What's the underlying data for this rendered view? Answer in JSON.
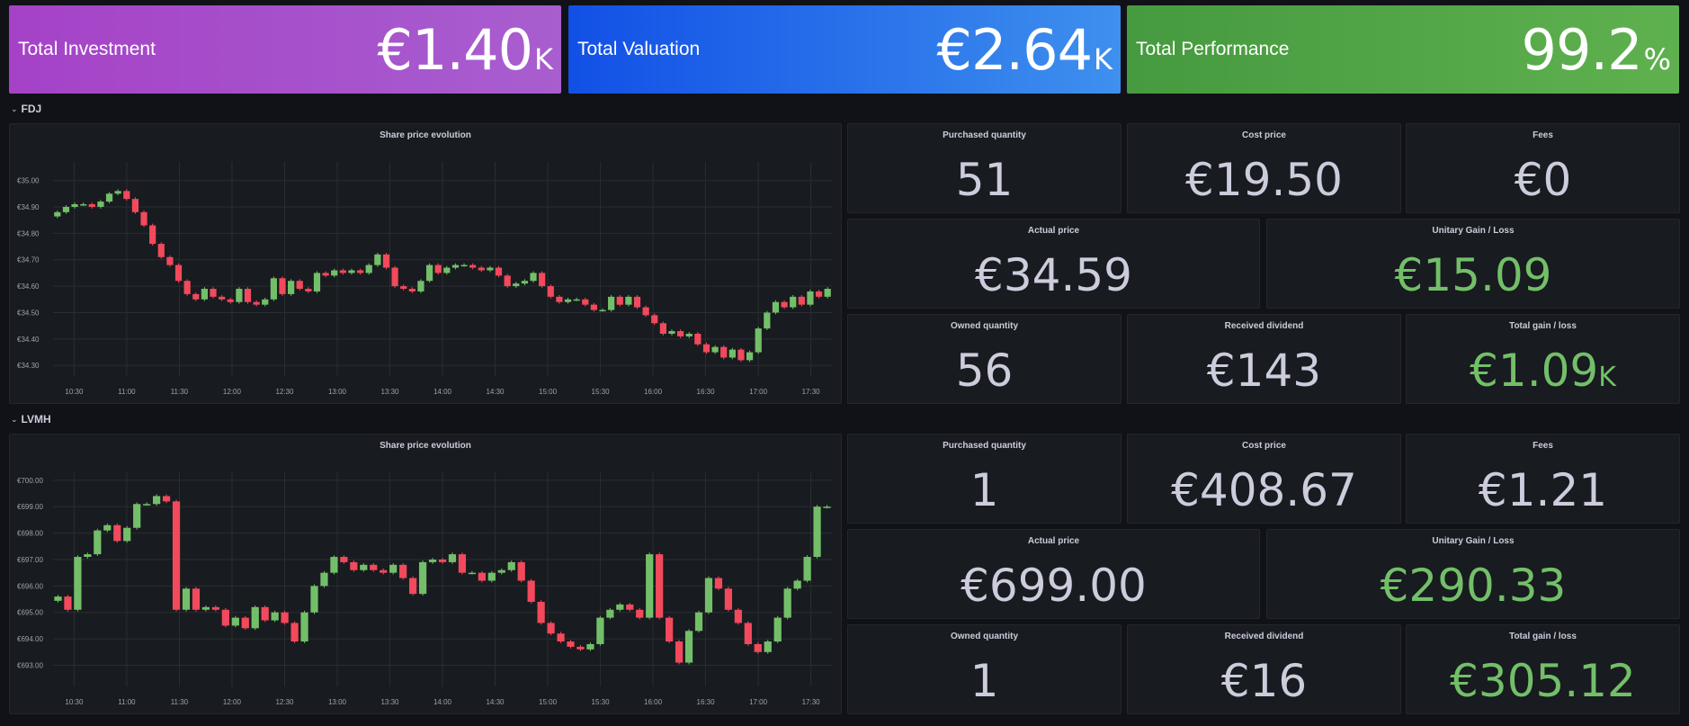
{
  "top": [
    {
      "label": "Total Investment",
      "value": "€1.40",
      "unit": "K",
      "gradient": [
        "#a542c7",
        "#a85ecf"
      ]
    },
    {
      "label": "Total Valuation",
      "value": "€2.64",
      "unit": "K",
      "gradient": [
        "#1250e6",
        "#3e90ee"
      ]
    },
    {
      "label": "Total Performance",
      "value": "99.2",
      "unit": "%",
      "gradient": [
        "#469a3f",
        "#5fb14f"
      ]
    }
  ],
  "fdj": {
    "row_title": "FDJ",
    "chart_title": "Share price evolution",
    "stats": {
      "purchased_quantity": {
        "label": "Purchased quantity",
        "value": "51"
      },
      "cost_price": {
        "label": "Cost price",
        "value": "€19.50"
      },
      "fees": {
        "label": "Fees",
        "value": "€0"
      },
      "actual_price": {
        "label": "Actual price",
        "value": "€34.59"
      },
      "unitary_gain": {
        "label": "Unitary Gain / Loss",
        "value": "€15.09"
      },
      "owned_quantity": {
        "label": "Owned quantity",
        "value": "56"
      },
      "received_dividend": {
        "label": "Received dividend",
        "value": "€143"
      },
      "total_gain": {
        "label": "Total gain / loss",
        "value": "€1.09",
        "unit": "K"
      }
    }
  },
  "lvmh": {
    "row_title": "LVMH",
    "chart_title": "Share price evolution",
    "stats": {
      "purchased_quantity": {
        "label": "Purchased quantity",
        "value": "1"
      },
      "cost_price": {
        "label": "Cost price",
        "value": "€408.67"
      },
      "fees": {
        "label": "Fees",
        "value": "€1.21"
      },
      "actual_price": {
        "label": "Actual price",
        "value": "€699.00"
      },
      "unitary_gain": {
        "label": "Unitary Gain / Loss",
        "value": "€290.33"
      },
      "owned_quantity": {
        "label": "Owned quantity",
        "value": "1"
      },
      "received_dividend": {
        "label": "Received dividend",
        "value": "€16"
      },
      "total_gain": {
        "label": "Total gain / loss",
        "value": "€305.12"
      }
    }
  },
  "colors": {
    "up": "#73bf69",
    "down": "#f2495c",
    "grid": "#2a2d33",
    "axis_text": "#9fa2aa"
  },
  "chart_data": [
    {
      "type": "candlestick",
      "title": "Share price evolution",
      "x_ticks": [
        "10:30",
        "11:00",
        "11:30",
        "12:00",
        "12:30",
        "13:00",
        "13:30",
        "14:00",
        "14:30",
        "15:00",
        "15:30",
        "16:00",
        "16:30",
        "17:00",
        "17:30"
      ],
      "y_ticks": [
        "€35.00",
        "€34.90",
        "€34.80",
        "€34.70",
        "€34.60",
        "€34.50",
        "€34.40",
        "€34.30"
      ],
      "ylim": [
        34.26,
        35.07
      ],
      "x_start": "10:18",
      "x_end": "17:42",
      "close": [
        34.88,
        34.9,
        34.91,
        34.91,
        34.9,
        34.92,
        34.95,
        34.96,
        34.93,
        34.88,
        34.83,
        34.76,
        34.71,
        34.68,
        34.62,
        34.57,
        34.55,
        34.59,
        34.56,
        34.55,
        34.54,
        34.59,
        34.54,
        34.53,
        34.55,
        34.63,
        34.57,
        34.62,
        34.59,
        34.58,
        34.65,
        34.64,
        34.66,
        34.65,
        34.66,
        34.65,
        34.68,
        34.72,
        34.67,
        34.6,
        34.59,
        34.58,
        34.62,
        34.68,
        34.65,
        34.67,
        34.68,
        34.68,
        34.67,
        34.66,
        34.67,
        34.64,
        34.6,
        34.61,
        34.62,
        34.65,
        34.6,
        34.56,
        34.54,
        34.55,
        34.55,
        34.53,
        34.51,
        34.51,
        34.56,
        34.53,
        34.56,
        34.52,
        34.49,
        34.46,
        34.42,
        34.43,
        34.41,
        34.42,
        34.38,
        34.35,
        34.37,
        34.33,
        34.36,
        34.32,
        34.35,
        34.44,
        34.5,
        34.54,
        34.52,
        34.56,
        34.53,
        34.58,
        34.56,
        34.59
      ]
    },
    {
      "type": "candlestick",
      "title": "Share price evolution",
      "x_ticks": [
        "10:30",
        "11:00",
        "11:30",
        "12:00",
        "12:30",
        "13:00",
        "13:30",
        "14:00",
        "14:30",
        "15:00",
        "15:30",
        "16:00",
        "16:30",
        "17:00",
        "17:30"
      ],
      "y_ticks": [
        "€700.00",
        "€699.00",
        "€698.00",
        "€697.00",
        "€696.00",
        "€695.00",
        "€694.00",
        "€693.00"
      ],
      "ylim": [
        692.2,
        700.3
      ],
      "x_start": "10:18",
      "x_end": "17:42",
      "close": [
        695.6,
        695.1,
        697.1,
        697.2,
        698.1,
        698.3,
        697.7,
        698.2,
        699.1,
        699.1,
        699.4,
        699.2,
        695.1,
        695.9,
        695.1,
        695.2,
        695.1,
        694.5,
        694.8,
        694.4,
        695.2,
        694.7,
        695.0,
        694.6,
        693.9,
        695.0,
        696.0,
        696.5,
        697.1,
        696.9,
        696.6,
        696.8,
        696.6,
        696.5,
        696.8,
        696.3,
        695.7,
        696.9,
        697.0,
        696.9,
        697.2,
        696.5,
        696.5,
        696.2,
        696.5,
        696.6,
        696.9,
        696.2,
        695.4,
        694.6,
        694.2,
        693.9,
        693.7,
        693.6,
        693.8,
        694.8,
        695.1,
        695.3,
        695.1,
        694.8,
        697.2,
        694.8,
        693.9,
        693.1,
        694.3,
        695.0,
        696.3,
        695.9,
        695.1,
        694.6,
        693.8,
        693.5,
        693.9,
        694.8,
        695.9,
        696.2,
        697.1,
        699.0,
        699.0
      ]
    }
  ]
}
